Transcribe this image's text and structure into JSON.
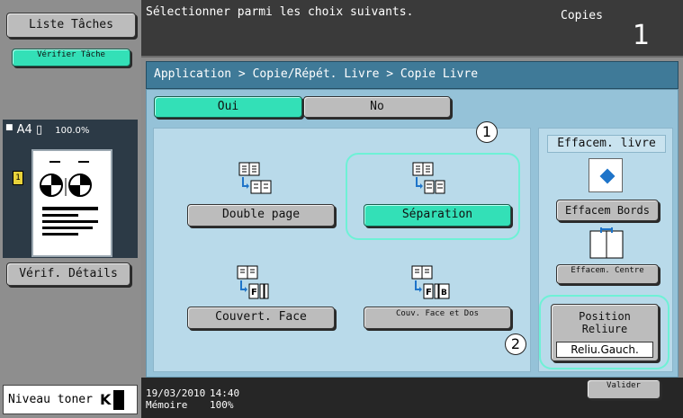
{
  "left_panel": {
    "job_list_label": "Liste Tâches",
    "check_job_label": "Vérifier Tâche",
    "preview_paper": "A4",
    "preview_zoom": "100.0%",
    "check_details_label": "Vérif. Détails",
    "toner_label": "Niveau toner",
    "toner_color": "K"
  },
  "header": {
    "message": "Sélectionner parmi les choix suivants.",
    "mode": "Copies",
    "copy_count": "1"
  },
  "breadcrumb": "Application > Copie/Répét. Livre > Copie Livre",
  "toggle": {
    "yes_label": "Oui",
    "no_label": "No"
  },
  "options": {
    "double_page": "Double page",
    "separation": "Séparation",
    "cover_face": "Couvert. Face",
    "cover_face_back": "Couv. Face et Dos"
  },
  "book_erase": {
    "title": "Effacem. livre",
    "erase_frame_label": "Effacem Bords",
    "erase_center_label": "Effacem. Centre"
  },
  "binding": {
    "title": "Position Reliure",
    "value": "Reliu.Gauch."
  },
  "callouts": [
    "1",
    "2"
  ],
  "footer": {
    "date": "19/03/2010",
    "time": "14:40",
    "memory_label": "Mémoire",
    "memory_value": "100%",
    "validate_label": "Valider"
  },
  "colors": {
    "accent": "#33e0b7",
    "panel": "#95c2d8",
    "header": "#3f7a98"
  }
}
